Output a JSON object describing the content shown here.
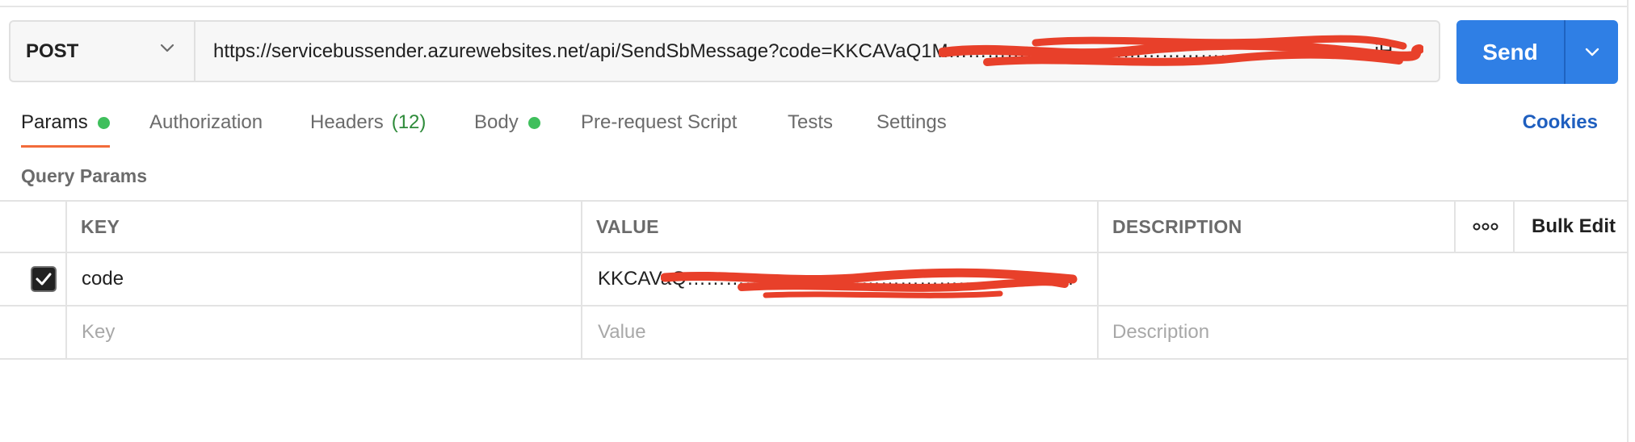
{
  "request": {
    "method": "POST",
    "url": "https://servicebussender.azurewebsites.net/api/SendSbMessage?code=KKCAVaQ1M…………………………………………………………iH..."
  },
  "send": {
    "label": "Send"
  },
  "tabs": [
    {
      "label": "Params",
      "indicator": "dot"
    },
    {
      "label": "Authorization"
    },
    {
      "label": "Headers",
      "count": "(12)"
    },
    {
      "label": "Body",
      "indicator": "dot"
    },
    {
      "label": "Pre-request Script"
    },
    {
      "label": "Tests"
    },
    {
      "label": "Settings"
    }
  ],
  "cookies_label": "Cookies",
  "section_title": "Query Params",
  "table": {
    "headers": {
      "key": "KEY",
      "value": "VALUE",
      "description": "DESCRIPTION",
      "bulk_edit": "Bulk Edit"
    },
    "rows": [
      {
        "checked": true,
        "key": "code",
        "value": "KKCAVaQ……………………………………………………………5...",
        "description": ""
      }
    ],
    "placeholders": {
      "key": "Key",
      "value": "Value",
      "description": "Description"
    }
  },
  "colors": {
    "accent_blue": "#2f7fe5",
    "active_tab_underline": "#f26b3a",
    "status_dot": "#3fbf5c",
    "cookies_link": "#1f5fbf",
    "redaction": "#e8402a"
  },
  "icons": {
    "method_dropdown": "chevron-down-icon",
    "send_dropdown": "chevron-down-icon",
    "row_menu": "more-horizontal-icon",
    "checkbox": "check-icon"
  }
}
